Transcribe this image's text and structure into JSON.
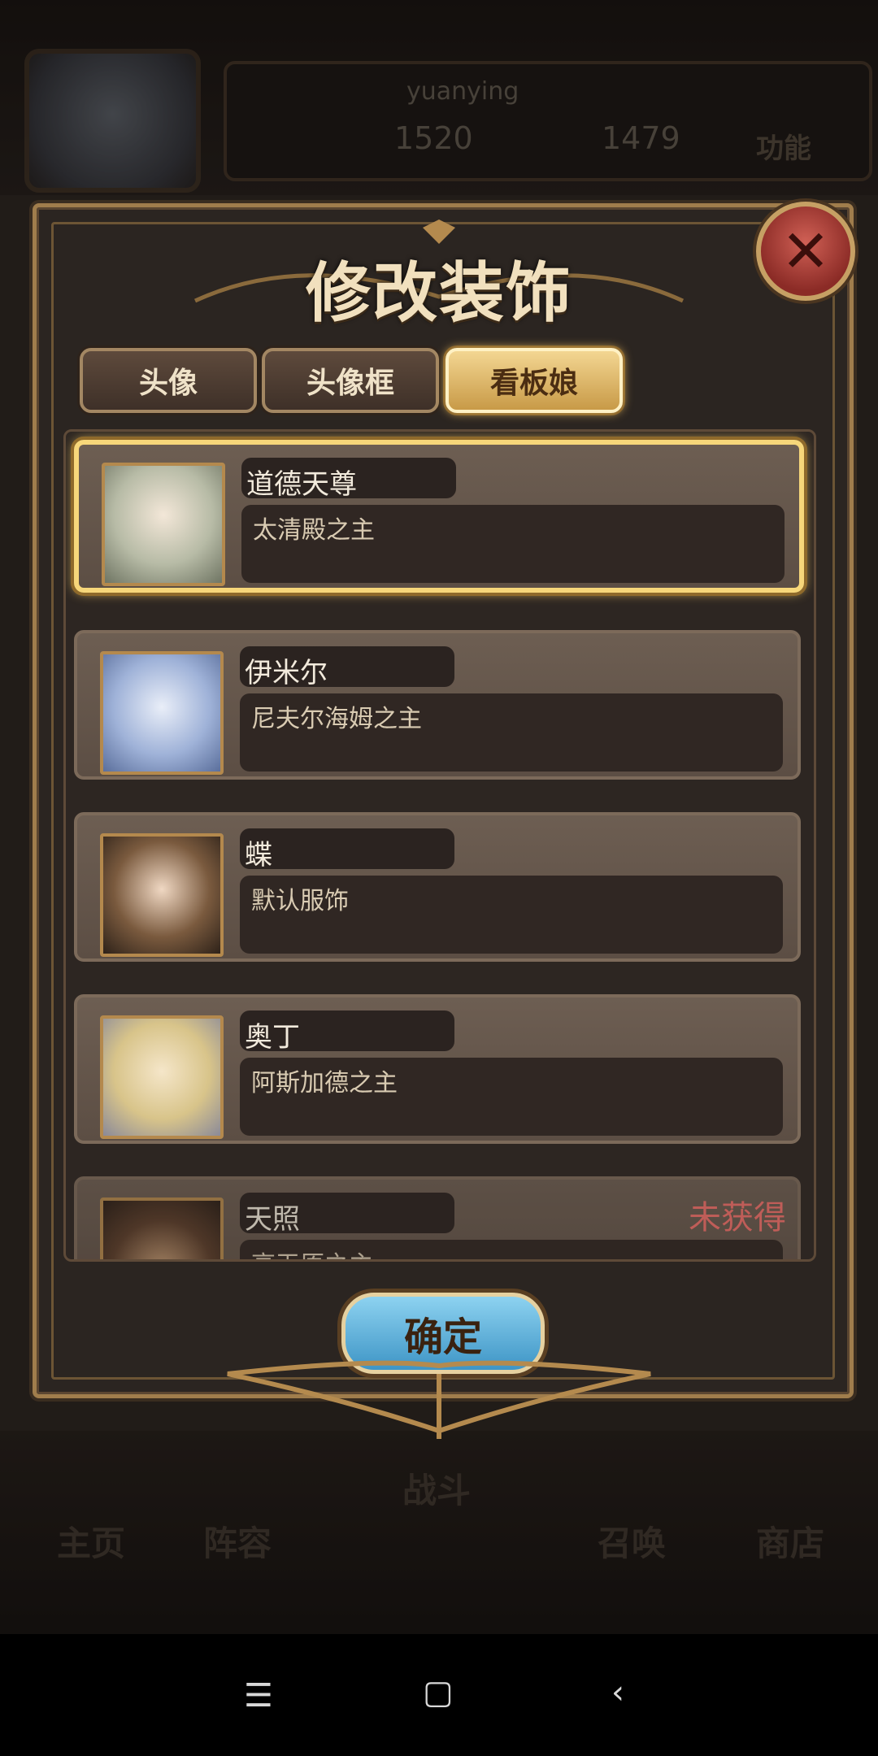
{
  "background": {
    "username": "yuanying",
    "currency_1": "1520",
    "currency_2": "1479",
    "function_label": "功能",
    "nav": [
      "主页",
      "阵容",
      "战斗",
      "召唤",
      "商店"
    ]
  },
  "modal": {
    "title": "修改装饰",
    "close_icon": "close-icon",
    "tabs": [
      {
        "label": "头像",
        "active": false
      },
      {
        "label": "头像框",
        "active": false
      },
      {
        "label": "看板娘",
        "active": true
      }
    ],
    "items": [
      {
        "name": "道德天尊",
        "desc": "太清殿之主",
        "status": "",
        "selected": true
      },
      {
        "name": "伊米尔",
        "desc": "尼夫尔海姆之主",
        "status": "",
        "selected": false
      },
      {
        "name": "蝶",
        "desc": "默认服饰",
        "status": "",
        "selected": false
      },
      {
        "name": "奥丁",
        "desc": "阿斯加德之主",
        "status": "",
        "selected": false
      },
      {
        "name": "天照",
        "desc": "高天原之主",
        "status": "未获得",
        "selected": false
      }
    ],
    "confirm_label": "确定"
  },
  "colors": {
    "accent_gold": "#f7d77a",
    "locked_red": "#f0706a",
    "confirm_blue": "#5fb4e0"
  }
}
